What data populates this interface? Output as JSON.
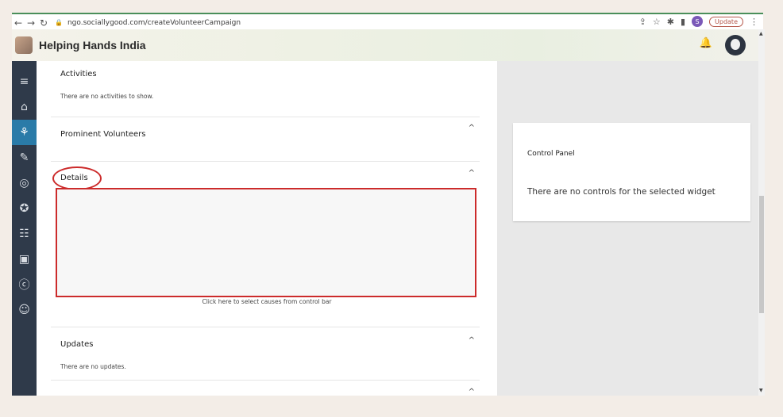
{
  "browser": {
    "url": "ngo.sociallygood.com/createVolunteerCampaign",
    "profile_initial": "S",
    "update_label": "Update"
  },
  "header": {
    "brand": "Helping Hands India"
  },
  "sidebar": {
    "items": [
      {
        "name": "menu-icon"
      },
      {
        "name": "home-icon"
      },
      {
        "name": "volunteer-icon",
        "active": true
      },
      {
        "name": "donate-icon"
      },
      {
        "name": "target-icon"
      },
      {
        "name": "award-icon"
      },
      {
        "name": "contacts-icon"
      },
      {
        "name": "ngo-icon"
      },
      {
        "name": "csr-icon"
      },
      {
        "name": "users-icon"
      }
    ]
  },
  "main": {
    "activities": {
      "title": "Activities",
      "desc": "There are no activities to show."
    },
    "prominent": {
      "title": "Prominent Volunteers"
    },
    "details": {
      "title": "Details",
      "caption": "Click here to select causes from control bar"
    },
    "updates": {
      "title": "Updates",
      "desc": "There are no updates."
    }
  },
  "control_panel": {
    "title": "Control Panel",
    "message": "There are no controls for the selected widget"
  },
  "colors": {
    "sidebar": "#2f3a4a",
    "sidebar_active": "#2a7ba8",
    "annotation_red": "#cc2b2b"
  }
}
